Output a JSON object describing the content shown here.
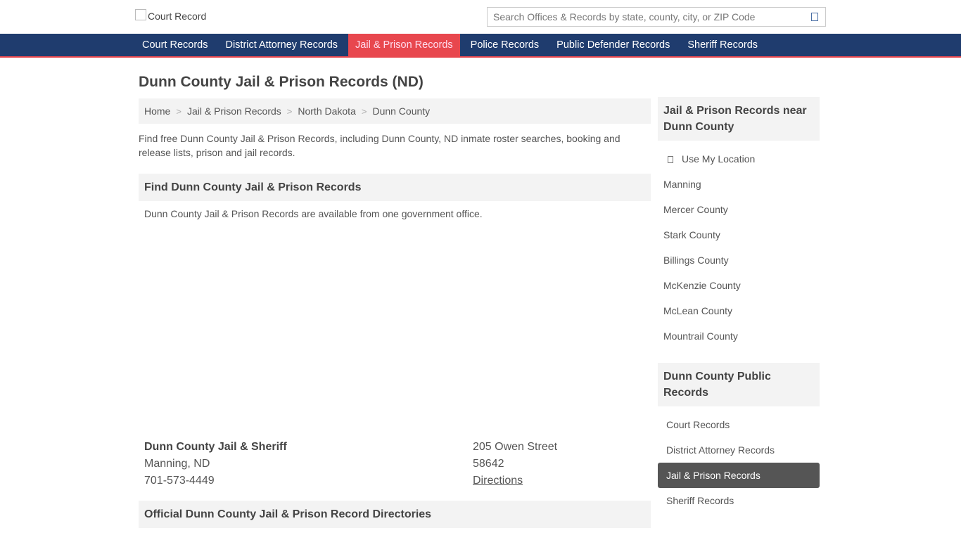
{
  "header": {
    "logo_alt": "Court Record",
    "search_placeholder": "Search Offices & Records by state, county, city, or ZIP Code"
  },
  "nav": {
    "items": [
      {
        "label": "Court Records"
      },
      {
        "label": "District Attorney Records"
      },
      {
        "label": "Jail & Prison Records",
        "active": true
      },
      {
        "label": "Police Records"
      },
      {
        "label": "Public Defender Records"
      },
      {
        "label": "Sheriff Records"
      }
    ]
  },
  "main": {
    "title": "Dunn County Jail & Prison Records (ND)",
    "breadcrumb": [
      "Home",
      "Jail & Prison Records",
      "North Dakota",
      "Dunn County"
    ],
    "breadcrumb_sep": ">",
    "intro": "Find free Dunn County Jail & Prison Records, including Dunn County, ND inmate roster searches, booking and release lists, prison and jail records.",
    "find_heading": "Find Dunn County Jail & Prison Records",
    "availability": "Dunn County Jail & Prison Records are available from one government office.",
    "office": {
      "name": "Dunn County Jail & Sheriff",
      "city": "Manning, ND",
      "phone": "701-573-4449",
      "street": "205 Owen Street",
      "zip": "58642",
      "directions": "Directions"
    },
    "directories_heading": "Official Dunn County Jail & Prison Record Directories"
  },
  "sidebar": {
    "nearby_heading": "Jail & Prison Records near Dunn County",
    "use_location": "Use My Location",
    "nearby": [
      "Manning",
      "Mercer County",
      "Stark County",
      "Billings County",
      "McKenzie County",
      "McLean County",
      "Mountrail County"
    ],
    "public_heading": "Dunn County Public Records",
    "public_records": [
      {
        "label": "Court Records"
      },
      {
        "label": "District Attorney Records"
      },
      {
        "label": "Jail & Prison Records",
        "active": true
      },
      {
        "label": "Sheriff Records"
      }
    ]
  },
  "colors": {
    "nav_bg": "#1f3c6e",
    "accent": "#e8474e",
    "panel_bg": "#f3f3f3",
    "active_side": "#555555"
  }
}
